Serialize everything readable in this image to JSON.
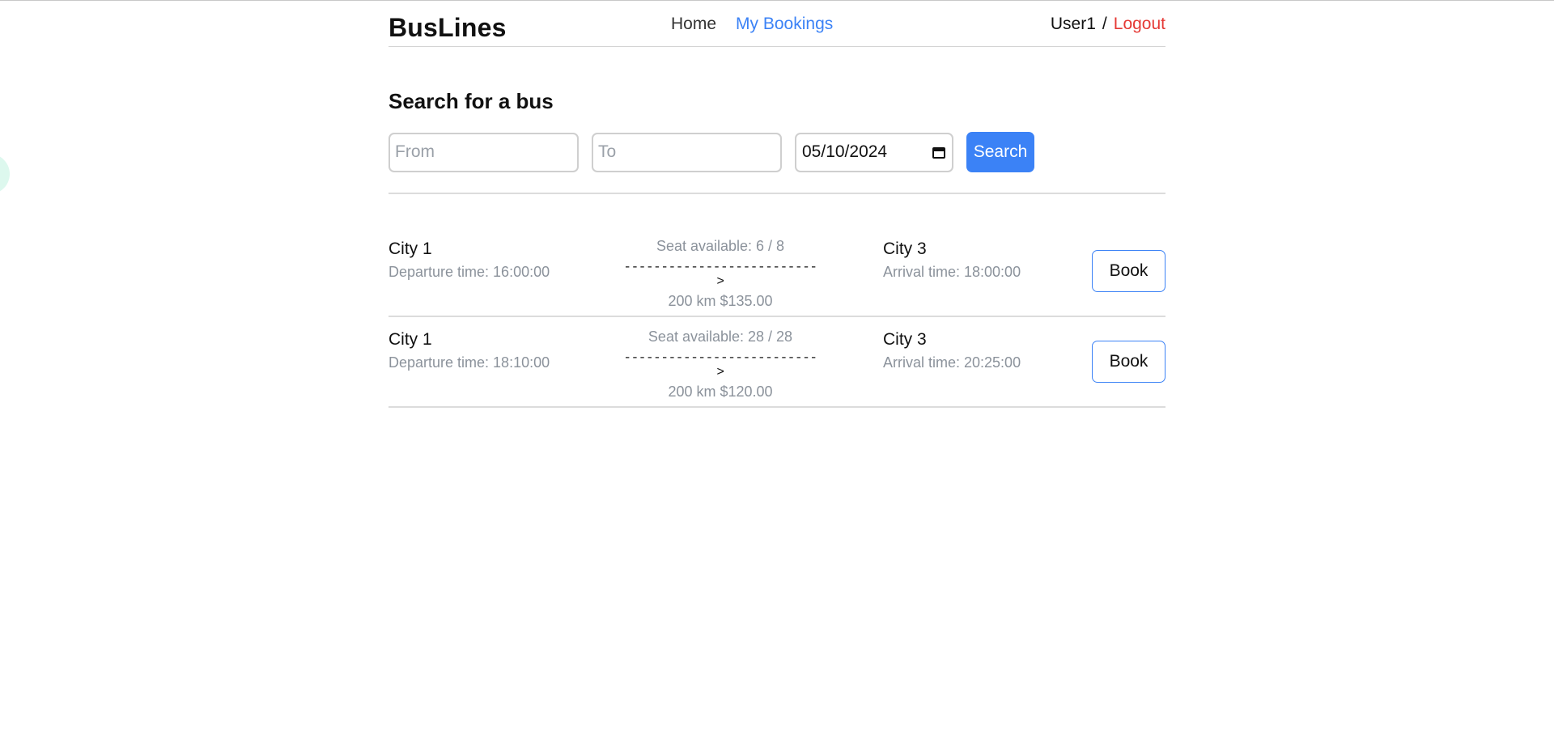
{
  "header": {
    "brand": "BusLines",
    "nav": {
      "home": "Home",
      "bookings": "My Bookings"
    },
    "user": "User1",
    "separator": "/",
    "logout": "Logout"
  },
  "search": {
    "title": "Search for a bus",
    "from_placeholder": "From",
    "to_placeholder": "To",
    "date_value": "05/10/2024",
    "button": "Search"
  },
  "colors": {
    "accent": "#3b82f6",
    "logout": "#e53935",
    "muted": "#8b929b"
  },
  "results": [
    {
      "from_city": "City 1",
      "departure": "Departure time: 16:00:00",
      "seats": "Seat available: 6 / 8",
      "arrow": "-------------------------->",
      "distance_price": "200 km $135.00",
      "to_city": "City 3",
      "arrival": "Arrival time: 18:00:00",
      "book": "Book"
    },
    {
      "from_city": "City 1",
      "departure": "Departure time: 18:10:00",
      "seats": "Seat available: 28 / 28",
      "arrow": "-------------------------->",
      "distance_price": "200 km $120.00",
      "to_city": "City 3",
      "arrival": "Arrival time: 20:25:00",
      "book": "Book"
    }
  ]
}
